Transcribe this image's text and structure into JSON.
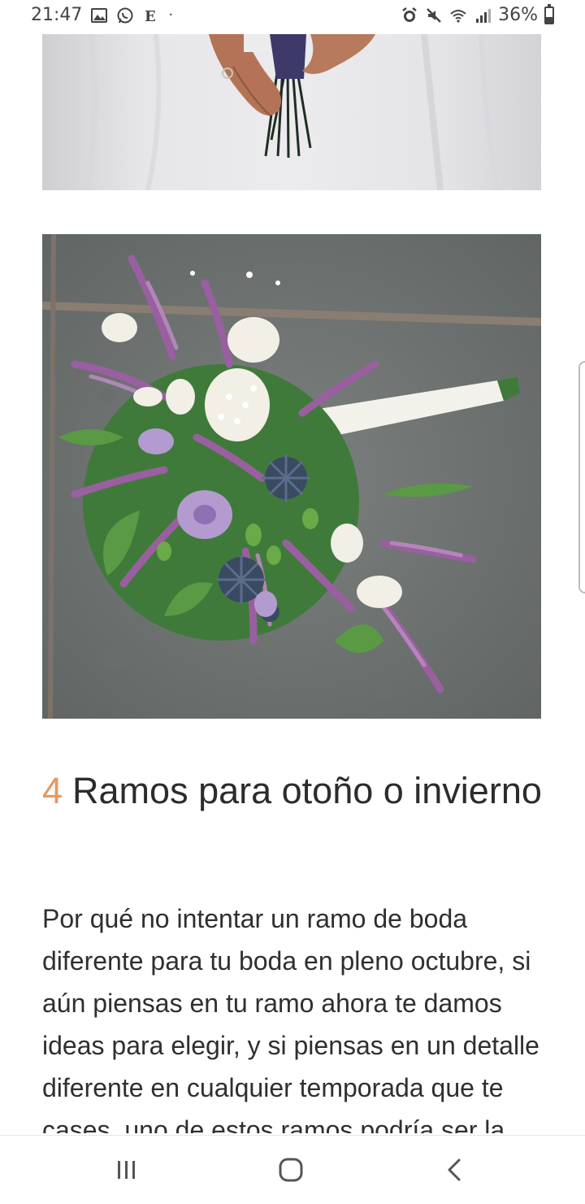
{
  "status_bar": {
    "time": "21:47",
    "left_icons": [
      "gallery-icon",
      "whatsapp-icon",
      "newspaper-icon"
    ],
    "dot": "·",
    "right_icons": [
      "alarm-icon",
      "mute-icon",
      "wifi-icon",
      "signal-icon"
    ],
    "battery_text": "36%"
  },
  "article": {
    "heading_number": "4",
    "heading_text": "Ramos para otoño o invierno",
    "paragraph": "Por qué no intentar un ramo de boda diferente para tu boda en pleno octubre, si aún piensas en tu ramo ahora te damos ideas para elegir, y si piensas en un detalle diferente en cualquier temporada que te cases, uno de estos ramos podría ser la"
  },
  "nav_bar": {
    "buttons": [
      "recent-apps-icon",
      "home-icon",
      "back-icon"
    ]
  },
  "colors": {
    "accent_number": "#e8985e",
    "text": "#2f2f2f",
    "stone": "#6f7473",
    "heather": "#9a5fa0"
  }
}
